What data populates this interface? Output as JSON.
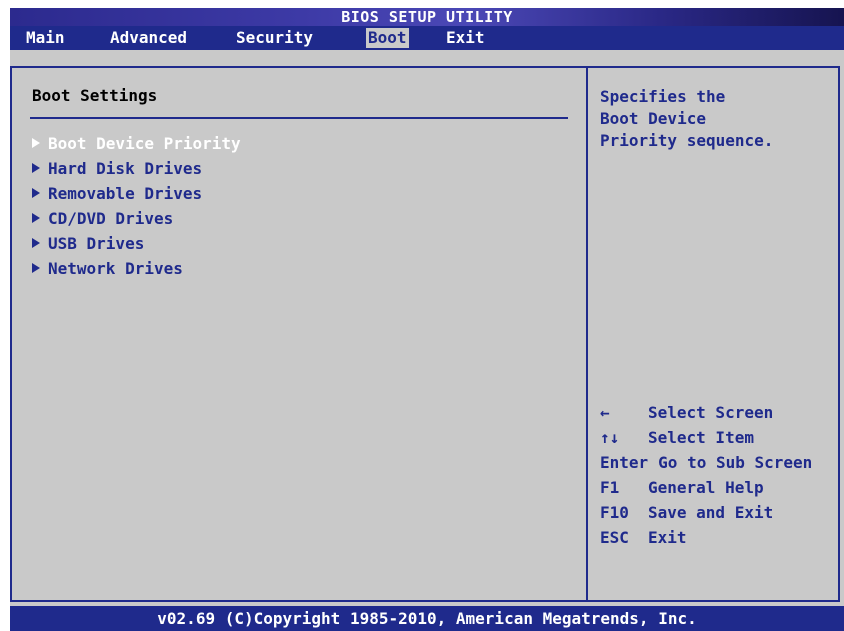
{
  "title": "BIOS SETUP UTILITY",
  "menu": {
    "items": [
      {
        "label": "Main"
      },
      {
        "label": "Advanced"
      },
      {
        "label": "Security"
      },
      {
        "label": "Boot"
      },
      {
        "label": "Exit"
      }
    ],
    "active": "Boot"
  },
  "main": {
    "section_title": "Boot Settings",
    "options": [
      {
        "label": "Boot Device Priority",
        "selected": true
      },
      {
        "label": "Hard Disk Drives"
      },
      {
        "label": "Removable Drives"
      },
      {
        "label": "CD/DVD Drives"
      },
      {
        "label": "USB Drives"
      },
      {
        "label": "Network Drives"
      }
    ]
  },
  "help": {
    "lines": [
      "Specifies the",
      "Boot Device",
      "Priority sequence."
    ]
  },
  "keys": [
    {
      "key": "←",
      "desc": "Select Screen"
    },
    {
      "key": "↑↓",
      "desc": "Select Item"
    },
    {
      "key": "Enter",
      "desc": "Go to Sub Screen"
    },
    {
      "key": "F1",
      "desc": "General Help"
    },
    {
      "key": "F10",
      "desc": "Save and Exit"
    },
    {
      "key": "ESC",
      "desc": "Exit"
    }
  ],
  "footer": "v02.69 (C)Copyright 1985-2010, American Megatrends, Inc.",
  "colors": {
    "background": "#c9c9c9",
    "accent": "#1f2a8c",
    "selected_text": "#ffffff",
    "heading_text": "#000000"
  }
}
